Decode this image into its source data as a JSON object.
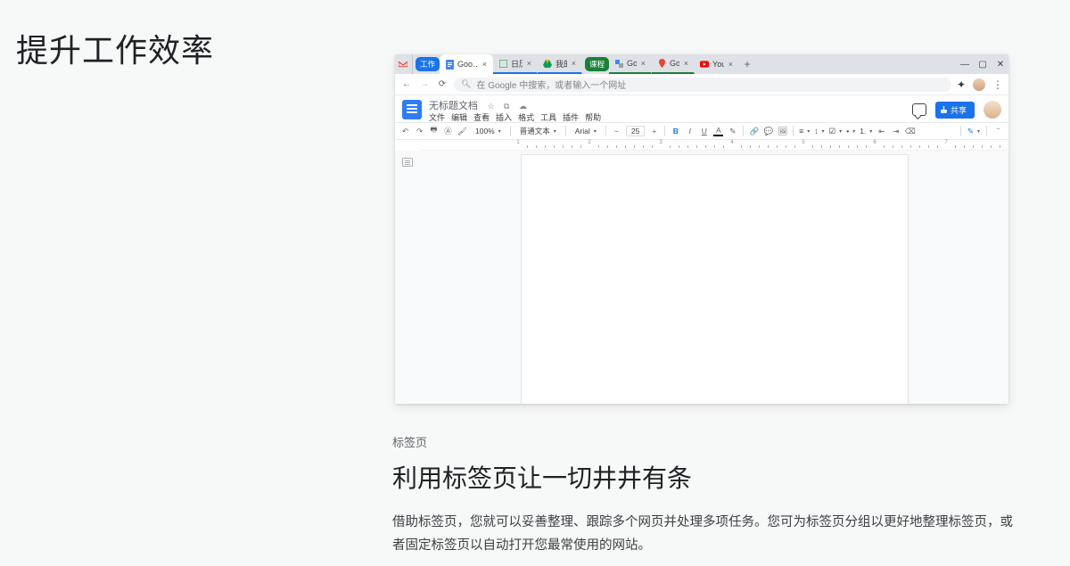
{
  "page": {
    "headline": "提升工作效率",
    "eyebrow": "标签页",
    "subheadline": "利用标签页让一切井井有条",
    "description": "借助标签页，您就可以妥善整理、跟踪多个网页并处理多项任务。您可为标签页分组以更好地整理标签页，或者固定标签页以自动打开您最常使用的网站。"
  },
  "browser": {
    "window_controls": {
      "min_title": "最小化",
      "max_title": "最大化",
      "close_title": "关闭"
    },
    "tab_groups": [
      {
        "label": "工作",
        "color": "#1a73e8"
      },
      {
        "label": "课程",
        "color": "#188038"
      }
    ],
    "tabs": [
      {
        "id": "gmail",
        "label": "",
        "active": false,
        "pinned": true
      },
      {
        "id": "docs",
        "label": "Goo…",
        "active": true
      },
      {
        "id": "calendar",
        "label": "日历",
        "active": false,
        "group": 0
      },
      {
        "id": "drive",
        "label": "我的…",
        "active": false,
        "group": 0
      },
      {
        "id": "translate",
        "label": "Go…",
        "active": false,
        "group": 1
      },
      {
        "id": "maps",
        "label": "Go…",
        "active": false,
        "group": 1
      },
      {
        "id": "youtube",
        "label": "You…",
        "active": false
      }
    ],
    "address_bar": {
      "placeholder": "在 Google 中搜索，或者输入一个网址"
    }
  },
  "docs": {
    "title": "无标题文档",
    "menus": [
      "文件",
      "编辑",
      "查看",
      "插入",
      "格式",
      "工具",
      "插件",
      "帮助"
    ],
    "share_label": "共享",
    "toolbar": {
      "zoom": "100%",
      "style": "普通文本",
      "font": "Arial",
      "font_size_minus": "−",
      "font_size": "25",
      "font_size_plus": "+"
    },
    "ruler_numbers": [
      "1",
      "2",
      "3",
      "4",
      "5",
      "6",
      "7"
    ]
  }
}
